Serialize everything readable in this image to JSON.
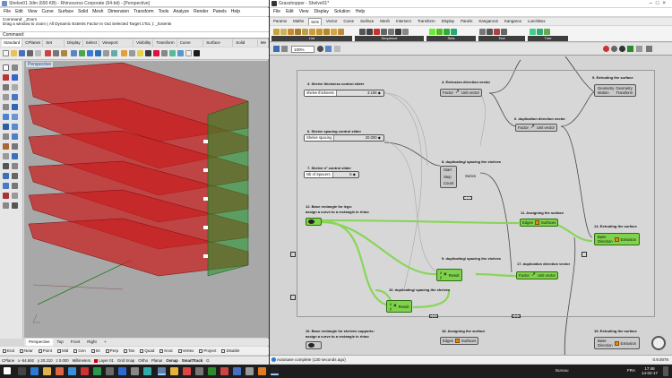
{
  "rhino": {
    "title": "Shelve01 3dm (690 KB) - Rhinoceros Corporate (64-bit) - [Perspective]",
    "menu": [
      "File",
      "Edit",
      "View",
      "Curve",
      "Surface",
      "Solid",
      "Mesh",
      "Dimension",
      "Transform",
      "Tools",
      "Analyze",
      "Render",
      "Panels",
      "Help"
    ],
    "command_history": [
      "Command: _Zoom",
      "Drag a window to zoom ( All Dynamic Extents Factor In Out Selected Target 1To1 ): _Extents"
    ],
    "command_prompt": "Command:",
    "tabs": [
      "Standard",
      "CPlanes",
      "Set View",
      "Display",
      "Select",
      "Viewport Layout",
      "Visibility",
      "Transform",
      "Curve Tools",
      "Surface Tools",
      "Solid Tools",
      "Me"
    ],
    "viewport_label": "Perspective",
    "viewport_tabs": [
      "Perspective",
      "Top",
      "Front",
      "Right",
      "+"
    ],
    "osnaps": [
      "End",
      "Near",
      "Point",
      "Mid",
      "Cen",
      "Int",
      "Perp",
      "Tan",
      "Quad",
      "Knot",
      "Vertex",
      "Project",
      "Disable"
    ],
    "status": {
      "cplane": "CPlane",
      "x": "x -54.692",
      "y": "y 20.210",
      "z": "z 0.000",
      "units": "Millimeters",
      "layer": "Layer 01",
      "items": [
        "Grid Snap",
        "Ortho",
        "Planar",
        "Osnap",
        "SmartTrack",
        "G"
      ]
    }
  },
  "gh": {
    "title": "Grasshopper - Shelve01*",
    "menu": [
      "File",
      "Edit",
      "View",
      "Display",
      "Solution",
      "Help"
    ],
    "tabs": [
      "Params",
      "Maths",
      "Sets",
      "Vector",
      "Curve",
      "Surface",
      "Mesh",
      "Intersect",
      "Transform",
      "Display",
      "Panels",
      "Kangaroo2",
      "Kangaroo",
      "LunchBox"
    ],
    "ribbon_groups": [
      "List",
      "Sequence",
      "Sets",
      "Text",
      "Tree"
    ],
    "zoom": "100%",
    "notes": {
      "n3": "3. Shelve thickness control slider",
      "n4": "4. Extrusion direction vector",
      "n5": "5. Extruding the surface",
      "n6": "6. Shelve spacing control slider",
      "n7": "7. Shelve n° control slider",
      "n8": "8. duplicating/ spacing  the shelves",
      "n9": "9. duplicating/ spacing  the shelves",
      "n10": "10. duplicating/ spacing  the shelves",
      "n11": "11. Assigning the surface",
      "n12a": "12. Base rectangle for legs:",
      "n12b": "assign a curve to a rectangle in rhino",
      "n13": "13. Extruding the surface",
      "n14": "14. Extruding the surface",
      "n16a": "16. Base rectangle for shelves supports:",
      "n16b": "assign a curve to a rectangle in rhino",
      "n17": "17. duplication direction vector",
      "n18": "18. Assigning the surface",
      "n19": "19. Extruding the surface",
      "n6b": "6. duplication direction vector"
    },
    "sliders": {
      "thickness_label": "shelve thickness",
      "thickness_value": "3.156 ◆",
      "spacing_label": "Shelve spacing",
      "spacing_value": "20.000 ◆",
      "count_label": "Nb of Spacers",
      "count_value": "5 ◆"
    },
    "components": {
      "factor": "Factor",
      "unit_vector": "Unit vector",
      "start": "Start",
      "step": "Step",
      "count": "Count",
      "series": "Series",
      "edges": "Edges",
      "surfaces": "Surfaces",
      "base": "Base",
      "direction": "Direction",
      "extrusion": "Extrusion",
      "geometry": "Geometry",
      "motion": "Motion",
      "transform": "Transform",
      "x": "x",
      "y": "y",
      "result": "Result"
    },
    "status_left": "Autosave complete (130 seconds ago)",
    "status_right": "0.9.0076"
  },
  "taskbar": {
    "lang": "FRA",
    "time": "17:48",
    "date": "14-02-17",
    "label": "Bureau"
  }
}
